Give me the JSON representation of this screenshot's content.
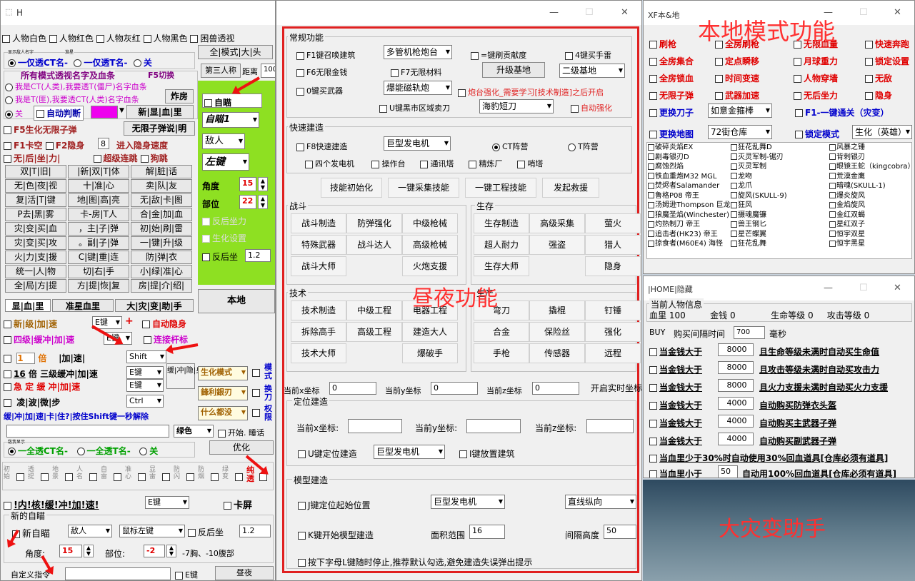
{
  "win1": {
    "title": "H",
    "controls": [
      "—",
      "☐",
      "✕"
    ],
    "chkrow": [
      "人物白色",
      "人物红色",
      "人物灰红",
      "人物黑色",
      "困兽透视"
    ],
    "radio1": {
      "small_label": "显示敌人名字",
      "small_label2": "准星",
      "opts": [
        "一仅透CT名-",
        "一仅透T名-",
        "关"
      ]
    },
    "btn_mode": "全|模式|大|头",
    "btn_third": "第三人称",
    "dist_label": "距离",
    "dist_val": "100",
    "all_mode_title": "所有模式透视名字及血条",
    "f5": "F5切换",
    "rad_a": "我是CT(人类),我要透T(僵尸)名字血条",
    "rad_b": "我是T(匪),我要透CT(人类)名字血条",
    "btn_zf": "炸房",
    "rad_c": "关",
    "auto_judge": "自动判断",
    "btn_xueli": "新|显|血|里",
    "f5bio": "F5生化无限子弹",
    "btn_wxzd": "无限子弹说|明",
    "f1": "F1卡空",
    "f2": "F2隐身",
    "f2val": "8",
    "jrys": "进入隐身速度",
    "wxh": "无|后|坐|力|",
    "cjjs": "超级连跳",
    "gf": "狗跳",
    "grid": [
      "双|T|旧|",
      "|新|双|T|体",
      "解|脏|话",
      "无|色|夜|视",
      "十|准|心",
      "卖|队|友",
      "复|活|T|键",
      "地|图|高|亮",
      "无|敌|卡|图",
      "P去|黑|雾",
      "卡-房|T人",
      "合|金|加|血",
      "灾|变|买|血",
      "，主|子|弹",
      "初|始|刷|雷",
      "灾|变|买|攻",
      "。副|子|弹",
      "一|键|升|级",
      "火|力|支|援",
      "C|键|重|连",
      "防|弹|衣",
      "统一|人|物",
      "切|右|手",
      "小|绿|准|心",
      "全|局|方|提",
      "方|提|恢|复",
      "房|提|介|绍|"
    ],
    "xuelitab": [
      "显|血|里",
      "准星血里",
      "大|灾|变|助|手"
    ],
    "newlevel": "新|级",
    "liaijia": "|加|速",
    "ejian": "E键",
    "plus": "+",
    "autohide": "自动隐身",
    "fourlv": "四级|缓冲|加|速",
    "ejian2": "E键",
    "lianjiegan": "连接杆标",
    "one": "1",
    "bei": "倍",
    "jiasu": "|加|速|",
    "shift": "Shift",
    "sixteen": "16",
    "bei2": "倍",
    "sanji": "三级缓冲|加|速",
    "ejian3": "E键",
    "jz": "急 定 缓 冲|加|速",
    "ejian4": "E键",
    "ling": "凌|波|微|步",
    "ctrl": "Ctrl",
    "hc": "缓|冲|隐|身",
    "shenghua": "生化模式",
    "jl": "鋒利銀刃",
    "shenm": "什么都没",
    "long": "缓|冲|加|速|卡|住?|按住Shift键一秒解除",
    "vert1": "模式",
    "vert2": "换刀",
    "vert3": "权限",
    "color": "绿色",
    "start_sleep": "开始. 睡话",
    "radio2": {
      "small_label": "敌我显示",
      "opts": [
        "一全透CT名-",
        "一全透T名-",
        "关"
      ]
    },
    "btn_yh": "优化",
    "ctrlrow": [
      "初始",
      "透提",
      "地景",
      "人名",
      "自雷",
      "准心",
      "显雷",
      "防闪",
      "防烟",
      "绿变",
      "纯透"
    ],
    "incl": "!内!核!缓!冲!加!速!",
    "ejian5": "E键",
    "kp": "卡屏",
    "newaim_grp": "新的自瞄",
    "newaim": "新自瞄",
    "enemy": "敌人",
    "mouse": "鼠标左键",
    "recoil": "反后坐",
    "recoil_v": "1.2",
    "angle": "角度:",
    "angle_v": "15",
    "part": "部位:",
    "part_v": "-2",
    "note": "-7胸、-10腹部",
    "custom": "自定义指令",
    "ejian6": "E键",
    "btn_zy": "昼夜",
    "aim_panel": {
      "self": "自瞄",
      "sel1": "自瞄1",
      "sel2": "敌人",
      "sel3": "左键",
      "angle": "角度",
      "angle_v": "15",
      "part": "部位",
      "part_v": "22",
      "recoil": "反后坐力",
      "bio": "生化设置",
      "back": "反后坐",
      "back_v": "1.2",
      "local": "本地"
    }
  },
  "win2": {
    "controls": [
      "—",
      "☐",
      "✕"
    ],
    "grp1": "常规功能",
    "f1": "F1键召唤建筑",
    "sel_mg": "多管机枪炮台",
    "eq": "=键刷贡献度",
    "k4": "4键买手雷",
    "f6": "F6无限金钱",
    "f7": "F7无限材料",
    "upbase": "升级基地",
    "base2": "二级基地",
    "k0": "0键买武器",
    "sel_cp": "爆能磁轨炮",
    "note_red": "炮台强化_需要学习[技术制造]之后开启",
    "u": "U键黑市区域卖刀",
    "sel_hj": "海豹短刀",
    "auto_str": "自动强化",
    "grp2": "快速建造",
    "f8": "F8快速建造",
    "sel_gen": "巨型发电机",
    "ct": "CT阵营",
    "t": "T阵营",
    "checks2": [
      "四个发电机",
      "操作台",
      "通讯塔",
      "精炼厂",
      "哨塔"
    ],
    "btns2": [
      "技能初始化",
      "一键采集技能",
      "一键工程技能",
      "发起救援"
    ],
    "fight": "战斗",
    "fight_btns": [
      "战斗制造",
      "防弹强化",
      "中级枪械",
      "特殊武器",
      "战斗达人",
      "高级枪械",
      "战斗大师",
      "",
      "火炮支援"
    ],
    "live": "生存",
    "live_btns": [
      "生存制造",
      "高级采集",
      "萤火",
      "超人耐力",
      "强盗",
      "猎人",
      "生存大师",
      "",
      "隐身"
    ],
    "tech": "技术",
    "tech_btns": [
      "技术制造",
      "中级工程",
      "电器工程",
      "拆除高手",
      "高级工程",
      "建造大人",
      "技术大师",
      "",
      "爆破手"
    ],
    "prod": "生产",
    "prod_btns": [
      "弯刀",
      "撬棍",
      "钉锤",
      "合金",
      "保险丝",
      "强化",
      "手枪",
      "传感器",
      "远程"
    ],
    "cx": "当前x坐标",
    "cx_v": "0",
    "cy": "当前y坐标",
    "cy_v": "0",
    "cz": "当前z坐标",
    "cz_v": "0",
    "realtime": "开启实时坐标",
    "grp3": "定位建造",
    "px": "当前x坐标:",
    "py": "当前y坐标:",
    "pz": "当前z坐标:",
    "uloc": "U键定位建造",
    "sel_gen2": "巨型发电机",
    "ibuild": "I键放置建筑",
    "grp4": "模型建造",
    "jpos": "J键定位起始位置",
    "sel_gen3": "巨型发电机",
    "dir": "直线纵向",
    "kbuild": "K键开始模型建造",
    "area": "面积范围",
    "area_v": "16",
    "gap": "间隔高度",
    "gap_v": "50",
    "note_l": "按下字母L键随时停止,推荐默认勾选,避免建造失误弹出提示",
    "overlay": "昼夜功能"
  },
  "win3": {
    "title": "XF本&地",
    "controls": [
      "—",
      "☐",
      "✕"
    ],
    "overlay": "本地模式功能",
    "items": [
      [
        "刷枪",
        "全房刷枪",
        "无限血量",
        "快速奔跑"
      ],
      [
        "全房集合",
        "定点瞬移",
        "月球重力",
        "锁定设置"
      ],
      [
        "全房锁血",
        "时间变速",
        "人物穿墙",
        "无敌"
      ],
      [
        "无限子弹",
        "武器加速",
        "无后坐力",
        "隐身"
      ]
    ],
    "changeknife": "更换刀子",
    "knife_sel": "如意金箍棒",
    "f1": "F1-一键通关（灾变）",
    "changemap": "更换地图",
    "map_sel": "72街仓库",
    "lockmode": "锁定模式",
    "mode_sel": "生化（英雄）",
    "list": [
      [
        "破碎炎焰EX",
        "狂花乱舞D",
        "风暴之锤"
      ],
      [
        "剧毒银刃D",
        "灭灵军制-锯刃",
        "背刺银刃"
      ],
      [
        "腐蚀烈焰",
        "灭灵军制",
        "眼镜王蛇（kingcobra）"
      ],
      [
        "铁血重炮M32 MGL",
        "龙吻",
        "荒漠金鹰"
      ],
      [
        "焚烬者Salamander",
        "龙爪",
        "暗魂(SKULL-1)"
      ],
      [
        "鲁格P08 帝王",
        "旋风(SKULL-9)",
        "爆炎旋风"
      ],
      [
        "汤姆逊Thompson 巨龙",
        "狂风",
        "金焰旋风"
      ],
      [
        "狼魔圣焰(Winchester)",
        "摄魂魔镰",
        "金红双蝎"
      ],
      [
        "灼热制刀 帝王",
        "兽王钢匕",
        "星红双子"
      ],
      [
        "追击者(HK23) 帝王",
        "星芒蝶翼",
        "恒宇双星"
      ],
      [
        "掠食者(M60E4) 海怪",
        "狂花乱舞",
        "恒宇黑星"
      ]
    ]
  },
  "win4": {
    "title": "|HOME|隐藏",
    "controls": [
      "—",
      "☐",
      "✕"
    ],
    "overlay": "大灾变助手",
    "info": "当前人物信息",
    "hp": "血里",
    "hp_v": "100",
    "money": "金钱",
    "money_v": "0",
    "lv": "生命等级",
    "lv_v": "0",
    "atk": "攻击等级",
    "atk_v": "0",
    "buy": "BUY",
    "interval": "购买间隔时间",
    "interval_v": "700",
    "ms": "毫秒",
    "rows": [
      [
        "当金钱大于",
        "8000",
        "且生命等级未满时自动买生命值"
      ],
      [
        "当金钱大于",
        "8000",
        "且攻击等级未满时自动买攻击力"
      ],
      [
        "当金钱大于",
        "8000",
        "且火力支援未满时自动买火力支援"
      ],
      [
        "当金钱大于",
        "4000",
        "自动购买防弹衣头盔"
      ],
      [
        "当金钱大于",
        "4000",
        "自动购买主武器子弹"
      ],
      [
        "当金钱大于",
        "4000",
        "自动购买副武器子弹"
      ]
    ],
    "row7": "当血里少于30%时自动使用30%回血道具[仓库必须有道具]",
    "row8a": "当血里小于",
    "row8v": "50",
    "row8b": "自动用100%回血道具[仓库必须有道具]"
  }
}
